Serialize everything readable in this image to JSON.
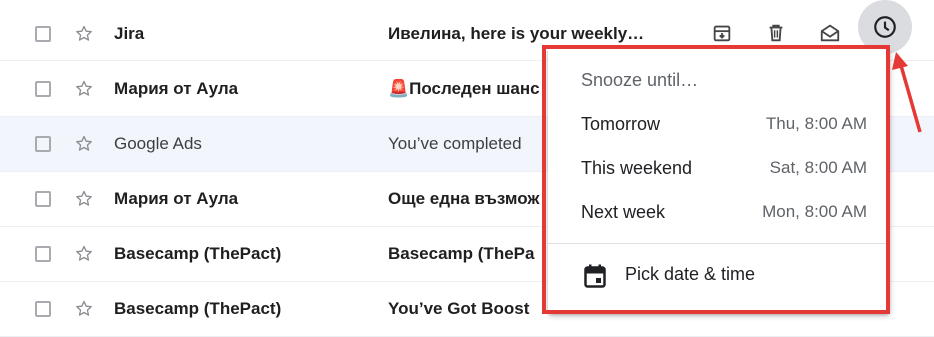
{
  "emails": [
    {
      "sender": "Jira",
      "subject": "Ивелина, here is your weekly…",
      "state": "unread"
    },
    {
      "sender": "Мария от Аула",
      "subject": "🚨Последен шанс",
      "state": "unread"
    },
    {
      "sender": "Google Ads",
      "subject": "You’ve completed",
      "state": "read"
    },
    {
      "sender": "Мария от Аула",
      "subject": "Още една възмож",
      "state": "unread"
    },
    {
      "sender": "Basecamp (ThePact)",
      "subject": "Basecamp (ThePa",
      "state": "unread"
    },
    {
      "sender": "Basecamp (ThePact)",
      "subject": "You’ve Got Boost",
      "state": "unread"
    }
  ],
  "hover_actions": [
    {
      "icon": "archive-icon"
    },
    {
      "icon": "delete-icon"
    },
    {
      "icon": "mark-as-read-icon"
    },
    {
      "icon": "snooze-clock-icon"
    }
  ],
  "snooze_menu": {
    "title": "Snooze until…",
    "options": [
      {
        "label": "Tomorrow",
        "time": "Thu, 8:00 AM"
      },
      {
        "label": "This weekend",
        "time": "Sat, 8:00 AM"
      },
      {
        "label": "Next week",
        "time": "Mon, 8:00 AM"
      }
    ],
    "pick_label": "Pick date & time",
    "pick_icon": "calendar-icon"
  },
  "colors": {
    "highlight": "#e53935",
    "accent_gray": "#5f6368",
    "read_row_bg": "#f2f6fc"
  }
}
